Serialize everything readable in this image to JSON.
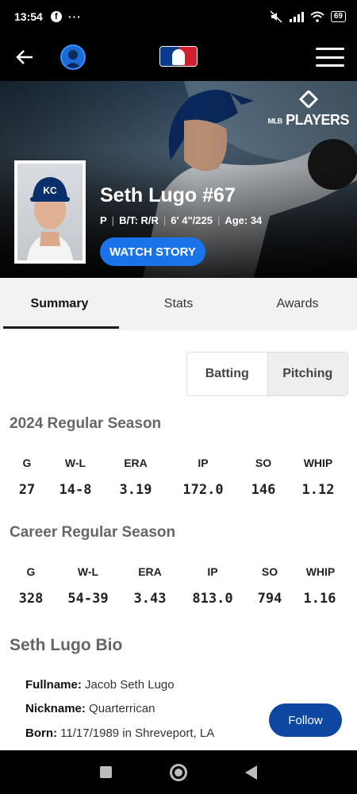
{
  "status_bar": {
    "time": "13:54",
    "dots": "···",
    "battery": "69"
  },
  "header": {
    "logo_icon": "mlb-logo",
    "back_icon": "arrow-left",
    "profile_icon": "user-avatar",
    "menu_icon": "hamburger-menu"
  },
  "hero": {
    "badge_text": "PLAYERS",
    "badge_prefix": "MLB",
    "name": "Seth Lugo #67",
    "meta": [
      "P",
      "B/T: R/R",
      "6' 4\"/225",
      "Age: 34"
    ],
    "watch_label": "WATCH STORY"
  },
  "tabs": [
    {
      "label": "Summary",
      "active": true
    },
    {
      "label": "Stats",
      "active": false
    },
    {
      "label": "Awards",
      "active": false
    }
  ],
  "toggle": {
    "batting": "Batting",
    "pitching": "Pitching"
  },
  "season": {
    "title": "2024 Regular Season",
    "headers": [
      "G",
      "W-L",
      "ERA",
      "IP",
      "SO",
      "WHIP"
    ],
    "values": [
      "27",
      "14-8",
      "3.19",
      "172.0",
      "146",
      "1.12"
    ]
  },
  "career": {
    "title": "Career Regular Season",
    "headers": [
      "G",
      "W-L",
      "ERA",
      "IP",
      "SO",
      "WHIP"
    ],
    "values": [
      "328",
      "54-39",
      "3.43",
      "813.0",
      "794",
      "1.16"
    ]
  },
  "bio": {
    "title": "Seth Lugo Bio",
    "fullname_label": "Fullname:",
    "fullname": "Jacob Seth Lugo",
    "nickname_label": "Nickname:",
    "nickname": "Quarterrican",
    "born_label": "Born:",
    "born": "11/17/1989 in Shreveport, LA"
  },
  "follow_label": "Follow"
}
